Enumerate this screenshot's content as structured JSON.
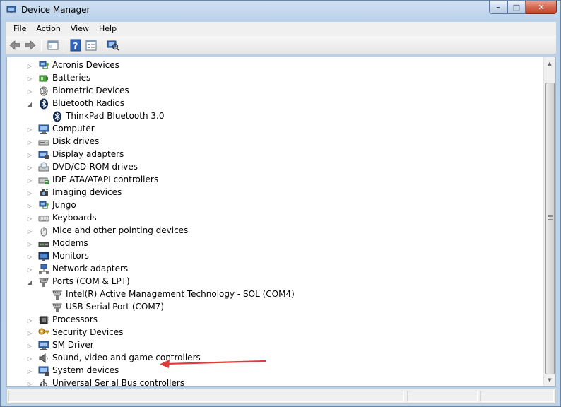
{
  "window": {
    "title": "Device Manager"
  },
  "caption_buttons": {
    "minimize": "–",
    "maximize": "□",
    "close": "✕"
  },
  "menu": [
    "File",
    "Action",
    "View",
    "Help"
  ],
  "toolbar": [
    {
      "icon": "back-arrow-icon"
    },
    {
      "icon": "forward-arrow-icon"
    },
    {
      "icon": "show-hide-console-tree-icon"
    },
    {
      "icon": "help-icon"
    },
    {
      "icon": "properties-icon"
    },
    {
      "icon": "scan-hardware-changes-icon"
    }
  ],
  "tree": [
    {
      "label": "Acronis Devices",
      "depth": 0,
      "state": "collapsed",
      "icon": "network-device-icon"
    },
    {
      "label": "Batteries",
      "depth": 0,
      "state": "collapsed",
      "icon": "battery-icon"
    },
    {
      "label": "Biometric Devices",
      "depth": 0,
      "state": "collapsed",
      "icon": "fingerprint-icon"
    },
    {
      "label": "Bluetooth Radios",
      "depth": 0,
      "state": "expanded",
      "icon": "bluetooth-icon"
    },
    {
      "label": "ThinkPad Bluetooth 3.0",
      "depth": 1,
      "state": "leaf",
      "icon": "bluetooth-icon"
    },
    {
      "label": "Computer",
      "depth": 0,
      "state": "collapsed",
      "icon": "computer-icon"
    },
    {
      "label": "Disk drives",
      "depth": 0,
      "state": "collapsed",
      "icon": "disk-drive-icon"
    },
    {
      "label": "Display adapters",
      "depth": 0,
      "state": "collapsed",
      "icon": "display-adapter-icon"
    },
    {
      "label": "DVD/CD-ROM drives",
      "depth": 0,
      "state": "collapsed",
      "icon": "dvd-drive-icon"
    },
    {
      "label": "IDE ATA/ATAPI controllers",
      "depth": 0,
      "state": "collapsed",
      "icon": "ide-controller-icon"
    },
    {
      "label": "Imaging devices",
      "depth": 0,
      "state": "collapsed",
      "icon": "camera-icon"
    },
    {
      "label": "Jungo",
      "depth": 0,
      "state": "collapsed",
      "icon": "network-device-icon"
    },
    {
      "label": "Keyboards",
      "depth": 0,
      "state": "collapsed",
      "icon": "keyboard-icon"
    },
    {
      "label": "Mice and other pointing devices",
      "depth": 0,
      "state": "collapsed",
      "icon": "mouse-icon"
    },
    {
      "label": "Modems",
      "depth": 0,
      "state": "collapsed",
      "icon": "modem-icon"
    },
    {
      "label": "Monitors",
      "depth": 0,
      "state": "collapsed",
      "icon": "monitor-icon"
    },
    {
      "label": "Network adapters",
      "depth": 0,
      "state": "collapsed",
      "icon": "network-adapter-icon"
    },
    {
      "label": "Ports (COM & LPT)",
      "depth": 0,
      "state": "expanded",
      "icon": "port-icon"
    },
    {
      "label": "Intel(R) Active Management Technology - SOL (COM4)",
      "depth": 1,
      "state": "leaf",
      "icon": "port-icon"
    },
    {
      "label": "USB Serial Port (COM7)",
      "depth": 1,
      "state": "leaf",
      "icon": "port-icon"
    },
    {
      "label": "Processors",
      "depth": 0,
      "state": "collapsed",
      "icon": "processor-icon"
    },
    {
      "label": "Security Devices",
      "depth": 0,
      "state": "collapsed",
      "icon": "security-key-icon"
    },
    {
      "label": "SM Driver",
      "depth": 0,
      "state": "collapsed",
      "icon": "computer-icon"
    },
    {
      "label": "Sound, video and game controllers",
      "depth": 0,
      "state": "collapsed",
      "icon": "speaker-icon"
    },
    {
      "label": "System devices",
      "depth": 0,
      "state": "collapsed",
      "icon": "system-devices-icon"
    },
    {
      "label": "Universal Serial Bus controllers",
      "depth": 0,
      "state": "collapsed",
      "icon": "usb-controller-icon"
    }
  ],
  "annotation": {
    "color": "#e03a3a",
    "icon": "red-arrow-pointer"
  }
}
